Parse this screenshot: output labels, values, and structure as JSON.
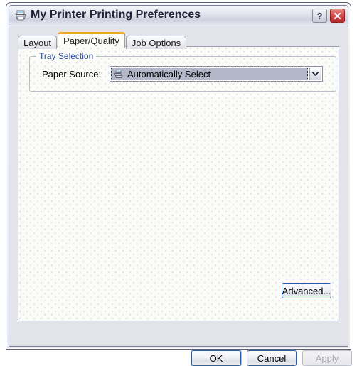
{
  "window": {
    "title": "My Printer Printing Preferences",
    "icon": "printer-icon",
    "help_label": "?",
    "close_label": "✕"
  },
  "tabs": [
    {
      "label": "Layout",
      "active": false
    },
    {
      "label": "Paper/Quality",
      "active": true
    },
    {
      "label": "Job Options",
      "active": false
    }
  ],
  "active_tab_accent": "#f0a723",
  "panel": {
    "group": {
      "legend": "Tray Selection",
      "legend_color": "#2a4b9b",
      "paper_source": {
        "label": "Paper Source:",
        "value": "Automatically Select",
        "icon": "paper-tray-icon",
        "dropdown_icon": "chevron-down-icon",
        "focused": true
      }
    },
    "advanced_button": "Advanced..."
  },
  "footer": {
    "ok": "OK",
    "cancel": "Cancel",
    "apply": "Apply",
    "apply_enabled": false
  }
}
